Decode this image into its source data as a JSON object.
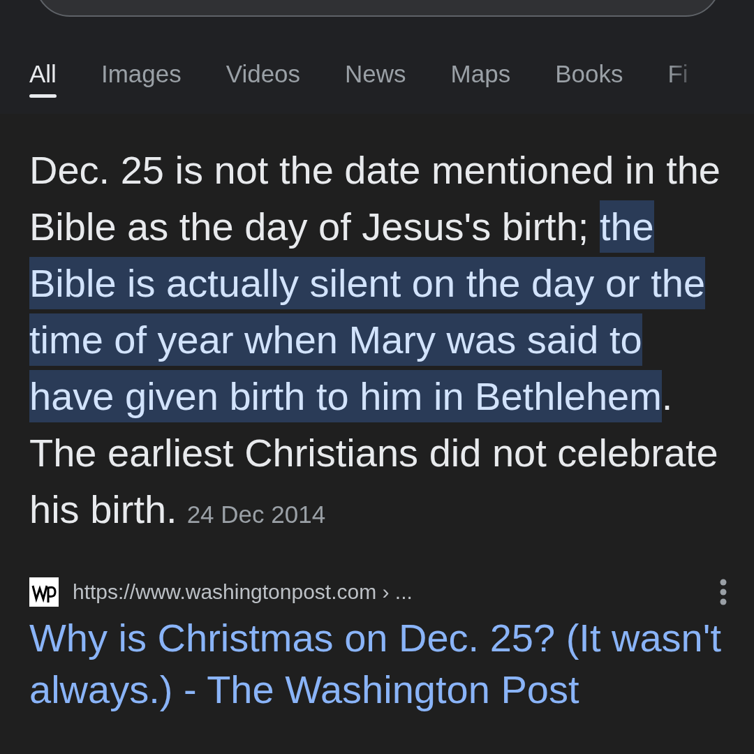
{
  "tabs": [
    {
      "label": "All",
      "selected": true
    },
    {
      "label": "Images",
      "selected": false
    },
    {
      "label": "Videos",
      "selected": false
    },
    {
      "label": "News",
      "selected": false
    },
    {
      "label": "Maps",
      "selected": false
    },
    {
      "label": "Books",
      "selected": false
    },
    {
      "label": "Fi",
      "selected": false
    }
  ],
  "snippet": {
    "segments": [
      {
        "text": "Dec. 25 is not the date mentioned in the Bible as the day of Jesus's birth; ",
        "highlighted": false
      },
      {
        "text": "the Bible is actually silent on the day or the time of year when Mary was said to have given birth to him in Bethlehem",
        "highlighted": true
      },
      {
        "text": ". The earliest Christians did not celebrate his birth.",
        "highlighted": false
      }
    ],
    "date": "24 Dec 2014"
  },
  "result": {
    "url": "https://www.washingtonpost.com › ...",
    "title": "Why is Christmas on Dec. 25? (It wasn't always.) - The Washington Post"
  }
}
